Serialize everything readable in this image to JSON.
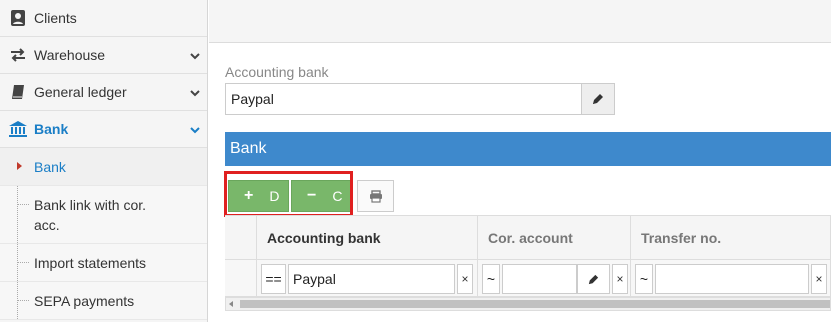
{
  "sidebar": {
    "items": [
      {
        "label": "Clients",
        "icon": "contacts-icon"
      },
      {
        "label": "Warehouse",
        "icon": "transfer-arrows-icon"
      },
      {
        "label": "General ledger",
        "icon": "book-icon"
      },
      {
        "label": "Bank",
        "icon": "bank-icon"
      }
    ],
    "subitems": [
      {
        "label": "Bank"
      },
      {
        "label": "Bank link with cor. acc."
      },
      {
        "label": "Import statements"
      },
      {
        "label": "SEPA payments"
      }
    ]
  },
  "form": {
    "accounting_bank_label": "Accounting bank",
    "accounting_bank_value": "Paypal"
  },
  "panel": {
    "title": "Bank",
    "add_debit_label": "D",
    "add_credit_label": "C"
  },
  "grid": {
    "columns": [
      "Accounting bank",
      "Cor. account",
      "Transfer no."
    ],
    "filter": {
      "operator": "==",
      "accounting_bank": "Paypal",
      "cor_operator": "~",
      "transfer_operator": "~",
      "clear": "×"
    }
  },
  "colors": {
    "accent": "#1a7ec6",
    "panel_header": "#3e89cc",
    "green_button": "#79b76a",
    "highlight": "#e02020"
  }
}
